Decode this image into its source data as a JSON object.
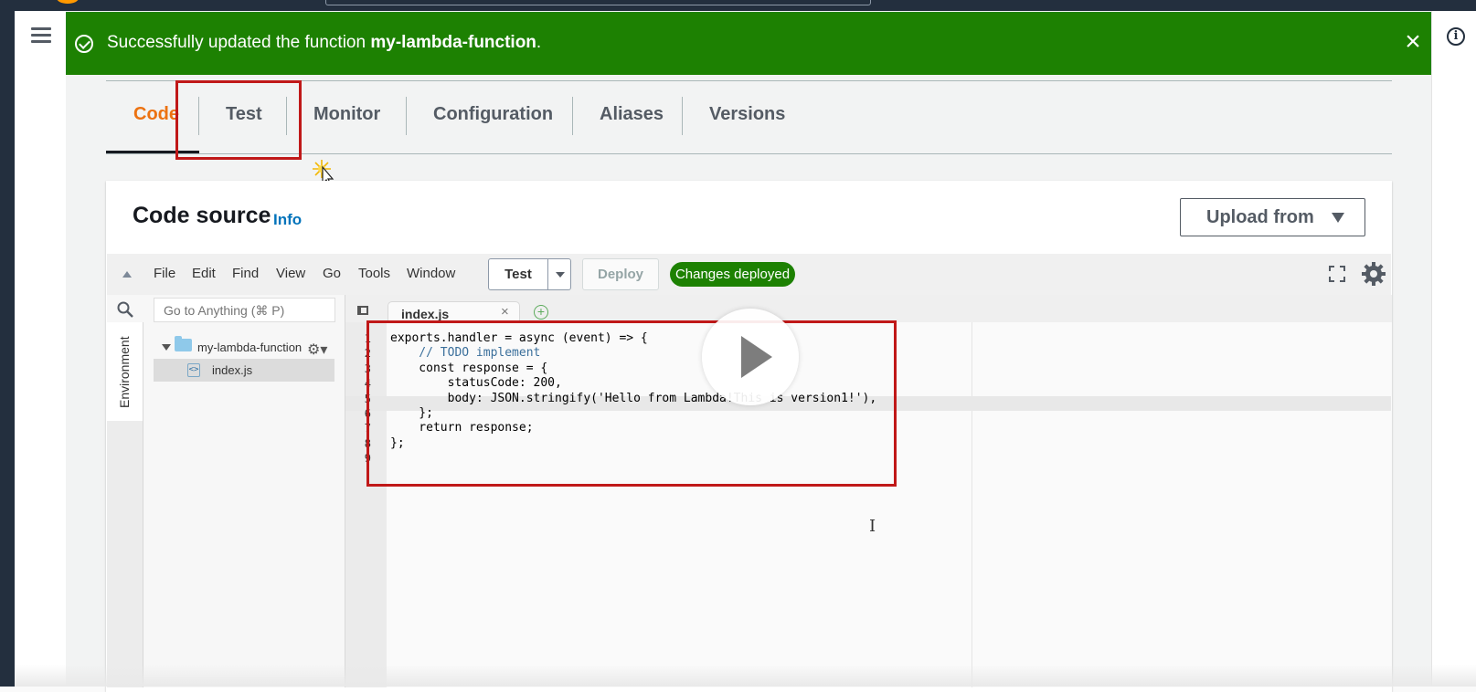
{
  "banner": {
    "prefix": "Successfully updated the function",
    "function_name": "my-lambda-function",
    "suffix": "."
  },
  "tabs": [
    "Code",
    "Test",
    "Monitor",
    "Configuration",
    "Aliases",
    "Versions"
  ],
  "active_tab": "Code",
  "code_source": {
    "title": "Code source",
    "info_link": "Info",
    "upload_label": "Upload from"
  },
  "ide": {
    "menu": [
      "File",
      "Edit",
      "Find",
      "View",
      "Go",
      "Tools",
      "Window"
    ],
    "test_label": "Test",
    "deploy_label": "Deploy",
    "status_badge": "Changes deployed",
    "search_placeholder": "Go to Anything (⌘ P)",
    "environment_label": "Environment",
    "folder_name": "my-lambda-function",
    "file_name": "index.js",
    "tab_name": "index.js",
    "close_glyph": "×",
    "add_glyph": "+"
  },
  "code_lines": [
    "exports.handler = async (event) => {",
    "    // TODO implement",
    "    const response = {",
    "        statusCode: 200,",
    "        body: JSON.stringify('Hello from Lambda!This is version1!'),",
    "    };",
    "    return response;",
    "};",
    ""
  ],
  "line_numbers": [
    "1",
    "2",
    "3",
    "4",
    "5",
    "6",
    "7",
    "8",
    "9"
  ],
  "colors": {
    "banner_green": "#1d8102",
    "active_tab_orange": "#ec7211",
    "highlight_red": "#c01818",
    "link_blue": "#0073bb"
  }
}
